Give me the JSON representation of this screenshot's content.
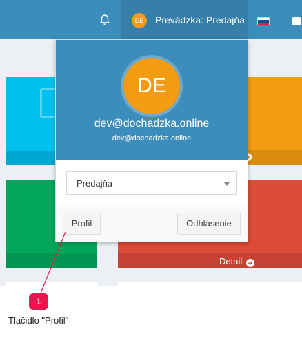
{
  "navbar": {
    "user_initials": "DE",
    "user_label": "Prevádzka: Predajňa",
    "icons": [
      "bell-icon",
      "slovak-flag-icon",
      "exit-icon"
    ]
  },
  "dropdown": {
    "avatar_initials": "DE",
    "email": "dev@dochadzka.online",
    "email_small": "dev@dochadzka.online",
    "select_value": "Predajňa",
    "profile_button": "Profil",
    "logout_button": "Odhlásenie"
  },
  "tiles": {
    "detail_label": "Detail"
  },
  "annotation": {
    "marker_number": "1",
    "caption": "Tlačidlo \"Profil\""
  },
  "colors": {
    "navbar": "#3c8dbc",
    "avatar": "#f39c12",
    "marker": "#e8164f"
  }
}
